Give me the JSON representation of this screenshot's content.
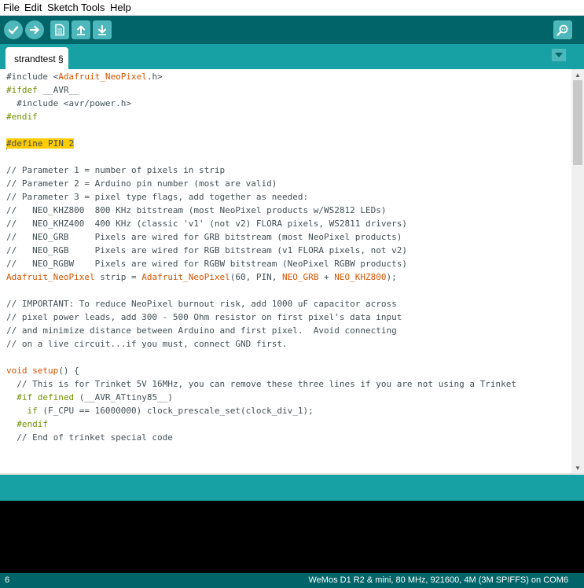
{
  "menu": [
    "File",
    "Edit",
    "Sketch",
    "Tools",
    "Help"
  ],
  "toolbar": {
    "buttons": [
      {
        "name": "verify-button",
        "icon": "check-icon"
      },
      {
        "name": "upload-button",
        "icon": "arrow-right-icon"
      },
      {
        "name": "new-button",
        "icon": "new-file-icon"
      },
      {
        "name": "open-button",
        "icon": "arrow-up-icon"
      },
      {
        "name": "save-button",
        "icon": "arrow-down-icon"
      }
    ],
    "serial_monitor_icon": "magnifier-icon"
  },
  "tabs": [
    {
      "label": "strandtest §"
    }
  ],
  "editor": {
    "lines": [
      [
        [
          "t",
          "#include <"
        ],
        [
          "cl",
          "Adafruit_NeoPixel"
        ],
        [
          "t",
          ".h>"
        ]
      ],
      [
        [
          "kw",
          "#ifdef"
        ],
        [
          "t",
          " __AVR__"
        ]
      ],
      [
        [
          "t",
          "  #include <avr/power.h>"
        ]
      ],
      [
        [
          "kw",
          "#endif"
        ]
      ],
      [],
      [
        [
          "cur",
          ""
        ],
        [
          "hl",
          "#define PIN 2"
        ]
      ],
      [],
      [
        [
          "t",
          "// Parameter 1 = number of pixels in strip"
        ]
      ],
      [
        [
          "t",
          "// Parameter 2 = Arduino pin number (most are valid)"
        ]
      ],
      [
        [
          "t",
          "// Parameter 3 = pixel type flags, add together as needed:"
        ]
      ],
      [
        [
          "t",
          "//   NEO_KHZ800  800 KHz bitstream (most NeoPixel products w/WS2812 LEDs)"
        ]
      ],
      [
        [
          "t",
          "//   NEO_KHZ400  400 KHz (classic 'v1' (not v2) FLORA pixels, WS2811 drivers)"
        ]
      ],
      [
        [
          "t",
          "//   NEO_GRB     Pixels are wired for GRB bitstream (most NeoPixel products)"
        ]
      ],
      [
        [
          "t",
          "//   NEO_RGB     Pixels are wired for RGB bitstream (v1 FLORA pixels, not v2)"
        ]
      ],
      [
        [
          "t",
          "//   NEO_RGBW    Pixels are wired for RGBW bitstream (NeoPixel RGBW products)"
        ]
      ],
      [
        [
          "cl",
          "Adafruit_NeoPixel"
        ],
        [
          "t",
          " strip = "
        ],
        [
          "cl",
          "Adafruit_NeoPixel"
        ],
        [
          "t",
          "(60, PIN, "
        ],
        [
          "cl",
          "NEO_GRB"
        ],
        [
          "t",
          " + "
        ],
        [
          "cl",
          "NEO_KHZ800"
        ],
        [
          "t",
          ");"
        ]
      ],
      [],
      [
        [
          "t",
          "// IMPORTANT: To reduce NeoPixel burnout risk, add 1000 uF capacitor across"
        ]
      ],
      [
        [
          "t",
          "// pixel power leads, add 300 - 500 Ohm resistor on first pixel's data input"
        ]
      ],
      [
        [
          "t",
          "// and minimize distance between Arduino and first pixel.  Avoid connecting"
        ]
      ],
      [
        [
          "t",
          "// on a live circuit...if you must, connect GND first."
        ]
      ],
      [],
      [
        [
          "cl",
          "void"
        ],
        [
          "t",
          " "
        ],
        [
          "cl",
          "setup"
        ],
        [
          "t",
          "() {"
        ]
      ],
      [
        [
          "t",
          "  // This is for Trinket 5V 16MHz, you can remove these three lines if you are not using a Trinket"
        ]
      ],
      [
        [
          "t",
          "  "
        ],
        [
          "kw",
          "#if"
        ],
        [
          "t",
          " "
        ],
        [
          "kw",
          "defined"
        ],
        [
          "t",
          " (__AVR_ATtiny85__)"
        ]
      ],
      [
        [
          "t",
          "    "
        ],
        [
          "kw",
          "if"
        ],
        [
          "t",
          " (F_CPU == 16000000) clock_prescale_set(clock_div_1);"
        ]
      ],
      [
        [
          "t",
          "  "
        ],
        [
          "kw",
          "#endif"
        ]
      ],
      [
        [
          "t",
          "  // End of trinket special code"
        ]
      ]
    ]
  },
  "colors": {
    "toolbar": "#006468",
    "tabbar": "#17a1a5",
    "button": "#4db7bb",
    "keyword": "#728e00",
    "class": "#d35400",
    "highlight": "#ffcc00"
  },
  "status": {
    "line": "6",
    "board": "WeMos D1 R2 & mini, 80 MHz, 921600, 4M (3M SPIFFS) on COM6"
  }
}
